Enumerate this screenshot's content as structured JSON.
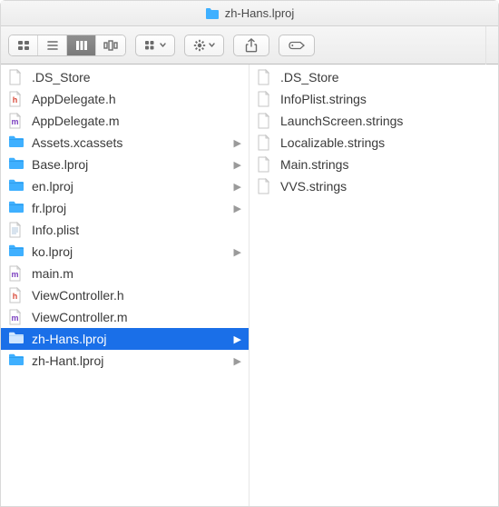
{
  "title": "zh-Hans.lproj",
  "columns": [
    {
      "items": [
        {
          "name": ".DS_Store",
          "icon": "doc",
          "folder": false,
          "letter": "",
          "selected": false
        },
        {
          "name": "AppDelegate.h",
          "icon": "h",
          "folder": false,
          "letter": "h",
          "selected": false
        },
        {
          "name": "AppDelegate.m",
          "icon": "m",
          "folder": false,
          "letter": "m",
          "selected": false
        },
        {
          "name": "Assets.xcassets",
          "icon": "folder",
          "folder": true,
          "letter": "",
          "selected": false
        },
        {
          "name": "Base.lproj",
          "icon": "folder",
          "folder": true,
          "letter": "",
          "selected": false
        },
        {
          "name": "en.lproj",
          "icon": "folder",
          "folder": true,
          "letter": "",
          "selected": false
        },
        {
          "name": "fr.lproj",
          "icon": "folder",
          "folder": true,
          "letter": "",
          "selected": false
        },
        {
          "name": "Info.plist",
          "icon": "plist",
          "folder": false,
          "letter": "",
          "selected": false
        },
        {
          "name": "ko.lproj",
          "icon": "folder",
          "folder": true,
          "letter": "",
          "selected": false
        },
        {
          "name": "main.m",
          "icon": "m",
          "folder": false,
          "letter": "m",
          "selected": false
        },
        {
          "name": "ViewController.h",
          "icon": "h",
          "folder": false,
          "letter": "h",
          "selected": false
        },
        {
          "name": "ViewController.m",
          "icon": "m",
          "folder": false,
          "letter": "m",
          "selected": false
        },
        {
          "name": "zh-Hans.lproj",
          "icon": "folder",
          "folder": true,
          "letter": "",
          "selected": true
        },
        {
          "name": "zh-Hant.lproj",
          "icon": "folder",
          "folder": true,
          "letter": "",
          "selected": false
        }
      ]
    },
    {
      "items": [
        {
          "name": ".DS_Store",
          "icon": "doc",
          "folder": false,
          "letter": "",
          "selected": false
        },
        {
          "name": "InfoPlist.strings",
          "icon": "doc",
          "folder": false,
          "letter": "",
          "selected": false
        },
        {
          "name": "LaunchScreen.strings",
          "icon": "doc",
          "folder": false,
          "letter": "",
          "selected": false
        },
        {
          "name": "Localizable.strings",
          "icon": "doc",
          "folder": false,
          "letter": "",
          "selected": false
        },
        {
          "name": "Main.strings",
          "icon": "doc",
          "folder": false,
          "letter": "",
          "selected": false
        },
        {
          "name": "VVS.strings",
          "icon": "doc",
          "folder": false,
          "letter": "",
          "selected": false
        }
      ]
    }
  ]
}
